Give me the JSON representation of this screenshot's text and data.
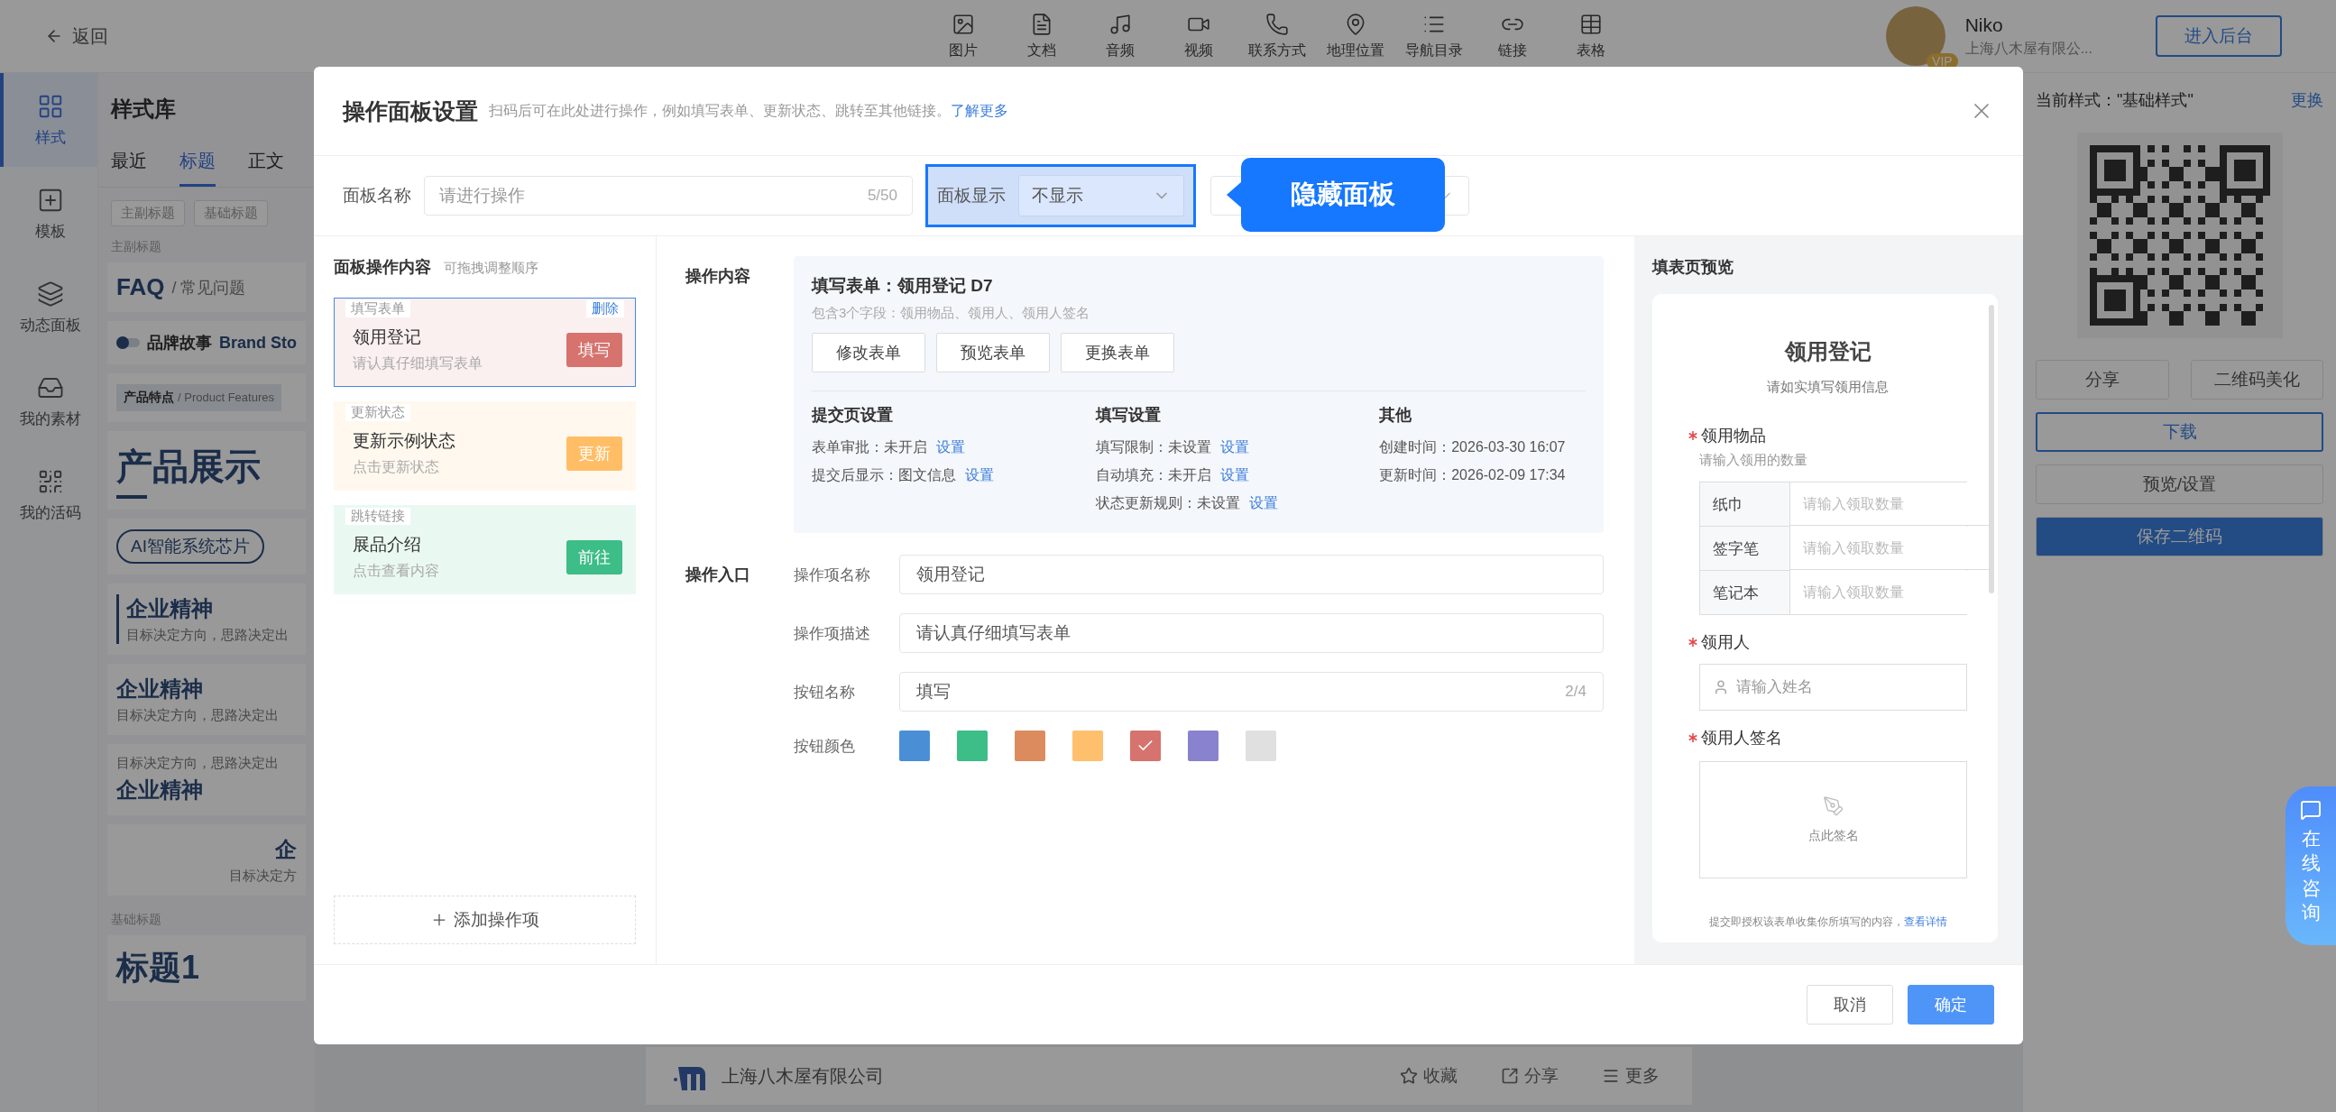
{
  "top_bar": {
    "back_label": "返回",
    "tools": [
      "图片",
      "文档",
      "音频",
      "视频",
      "联系方式",
      "地理位置",
      "导航目录",
      "链接",
      "表格"
    ],
    "user_name": "Niko",
    "user_badge": "VIP",
    "user_org": "上海八木屋有限公...",
    "admin_button": "进入后台"
  },
  "nav_rail": [
    {
      "label": "样式",
      "selected": true
    },
    {
      "label": "模板",
      "selected": false
    },
    {
      "label": "动态面板",
      "selected": false
    },
    {
      "label": "我的素材",
      "selected": false
    },
    {
      "label": "我的活码",
      "selected": false
    }
  ],
  "style_library": {
    "title": "样式库",
    "tabs": [
      {
        "label": "最近",
        "selected": false
      },
      {
        "label": "标题",
        "selected": true
      },
      {
        "label": "正文",
        "selected": false
      }
    ],
    "chips": [
      "主副标题",
      "基础标题"
    ],
    "groups": [
      {
        "label": "主副标题",
        "items": [
          {
            "kind": "faq",
            "title": "FAQ",
            "subtitle": "/ 常见问题"
          },
          {
            "kind": "toggle",
            "title": "品牌故事",
            "subtitle": "Brand Sto"
          },
          {
            "kind": "banner",
            "title": "产品特点",
            "subtitle": "/ Product Features"
          },
          {
            "kind": "big",
            "title": "产品展示"
          },
          {
            "kind": "pill",
            "title": "AI智能系统芯片"
          },
          {
            "kind": "bar",
            "title": "企业精神",
            "subtitle": "目标决定方向，思路决定出"
          },
          {
            "kind": "stack",
            "title": "企业精神",
            "subtitle": "目标决定方向，思路决定出"
          },
          {
            "kind": "reverse",
            "title": "企业精神",
            "subtitle": "目标决定方向，思路决定出"
          },
          {
            "kind": "center",
            "title": "企",
            "subtitle": "目标决定方"
          }
        ]
      },
      {
        "label": "基础标题",
        "items": [
          {
            "kind": "heading",
            "title": "标题1"
          }
        ]
      }
    ]
  },
  "canvas_footer": {
    "company": "上海八木屋有限公司",
    "actions": [
      "收藏",
      "分享",
      "更多"
    ]
  },
  "right_panel": {
    "current_style": "当前样式：\"基础样式\"",
    "change_link": "更换",
    "buttons": [
      {
        "kind": "half",
        "label": "分享"
      },
      {
        "kind": "half",
        "label": "二维码美化"
      },
      {
        "kind": "outline",
        "label": "下载"
      },
      {
        "kind": "full",
        "label": "预览/设置"
      },
      {
        "kind": "primary",
        "label": "保存二维码"
      }
    ]
  },
  "consult_button": "在线咨询",
  "dialog": {
    "title": "操作面板设置",
    "subtitle": "扫码后可在此处进行操作，例如填写表单、更新状态、跳转至其他链接。",
    "learn_more": "了解更多",
    "panel_name": {
      "label": "面板名称",
      "placeholder": "请进行操作",
      "count": "5/50"
    },
    "panel_display": {
      "label": "面板显示",
      "value": "不显示"
    },
    "callout": "隐藏面板",
    "actions_panel": {
      "title": "面板操作内容",
      "hint": "可拖拽调整顺序",
      "delete_link": "删除",
      "add_button": "添加操作项",
      "actions": [
        {
          "tag": "填写表单",
          "title": "领用登记",
          "desc": "请认真仔细填写表单",
          "button": "填写",
          "color": "#d6736e",
          "selected": true
        },
        {
          "tag": "更新状态",
          "title": "更新示例状态",
          "desc": "点击更新状态",
          "button": "更新",
          "color": "#ffbe66",
          "selected": false
        },
        {
          "tag": "跳转链接",
          "title": "展品介绍",
          "desc": "点击查看内容",
          "button": "前往",
          "color": "#3dbd87",
          "selected": false
        }
      ]
    },
    "content": {
      "label": "操作内容",
      "form_title": "填写表单：领用登记 D7",
      "form_desc": "包含3个字段：领用物品、领用人、领用人签名",
      "buttons": [
        "修改表单",
        "预览表单",
        "更换表单"
      ],
      "settings": [
        {
          "title": "提交页设置",
          "rows": [
            {
              "text": "表单审批：未开启",
              "link": "设置"
            },
            {
              "text": "提交后显示：图文信息",
              "link": "设置"
            }
          ]
        },
        {
          "title": "填写设置",
          "rows": [
            {
              "text": "填写限制：未设置",
              "link": "设置"
            },
            {
              "text": "自动填充：未开启",
              "link": "设置"
            },
            {
              "text": "状态更新规则：未设置",
              "link": "设置"
            }
          ]
        },
        {
          "title": "其他",
          "rows": [
            {
              "text": "创建时间：2026-03-30 16:07"
            },
            {
              "text": "更新时间：2026-02-09 17:34"
            }
          ]
        }
      ]
    },
    "entry": {
      "label": "操作入口",
      "fields": [
        {
          "label": "操作项名称",
          "value": "领用登记"
        },
        {
          "label": "操作项描述",
          "value": "请认真仔细填写表单"
        },
        {
          "label": "按钮名称",
          "value": "填写",
          "count": "2/4"
        }
      ],
      "color_label": "按钮颜色",
      "swatches": [
        {
          "color": "#4a8fd6",
          "selected": false
        },
        {
          "color": "#3dbd87",
          "selected": false
        },
        {
          "color": "#dc8b5e",
          "selected": false
        },
        {
          "color": "#ffc06e",
          "selected": false
        },
        {
          "color": "#d6736e",
          "selected": true
        },
        {
          "color": "#8983cf",
          "selected": false
        },
        {
          "color": "#e0e0e0",
          "selected": false
        }
      ]
    },
    "preview": {
      "title": "填表页预览",
      "form_title": "领用登记",
      "form_subtitle": "请如实填写领用信息",
      "fields": [
        {
          "kind": "table",
          "label": "领用物品",
          "required": true,
          "hint": "请输入领用的数量",
          "rows": [
            {
              "item": "纸巾",
              "placeholder": "请输入领取数量"
            },
            {
              "item": "签字笔",
              "placeholder": "请输入领取数量"
            },
            {
              "item": "笔记本",
              "placeholder": "请输入领取数量"
            }
          ]
        },
        {
          "kind": "text",
          "label": "领用人",
          "required": true,
          "placeholder": "请输入姓名"
        },
        {
          "kind": "signature",
          "label": "领用人签名",
          "required": true,
          "prompt": "点此签名"
        }
      ],
      "notice": "提交即授权该表单收集你所填写的内容，",
      "notice_link": "查看详情"
    },
    "footer": {
      "cancel": "取消",
      "confirm": "确定"
    }
  }
}
